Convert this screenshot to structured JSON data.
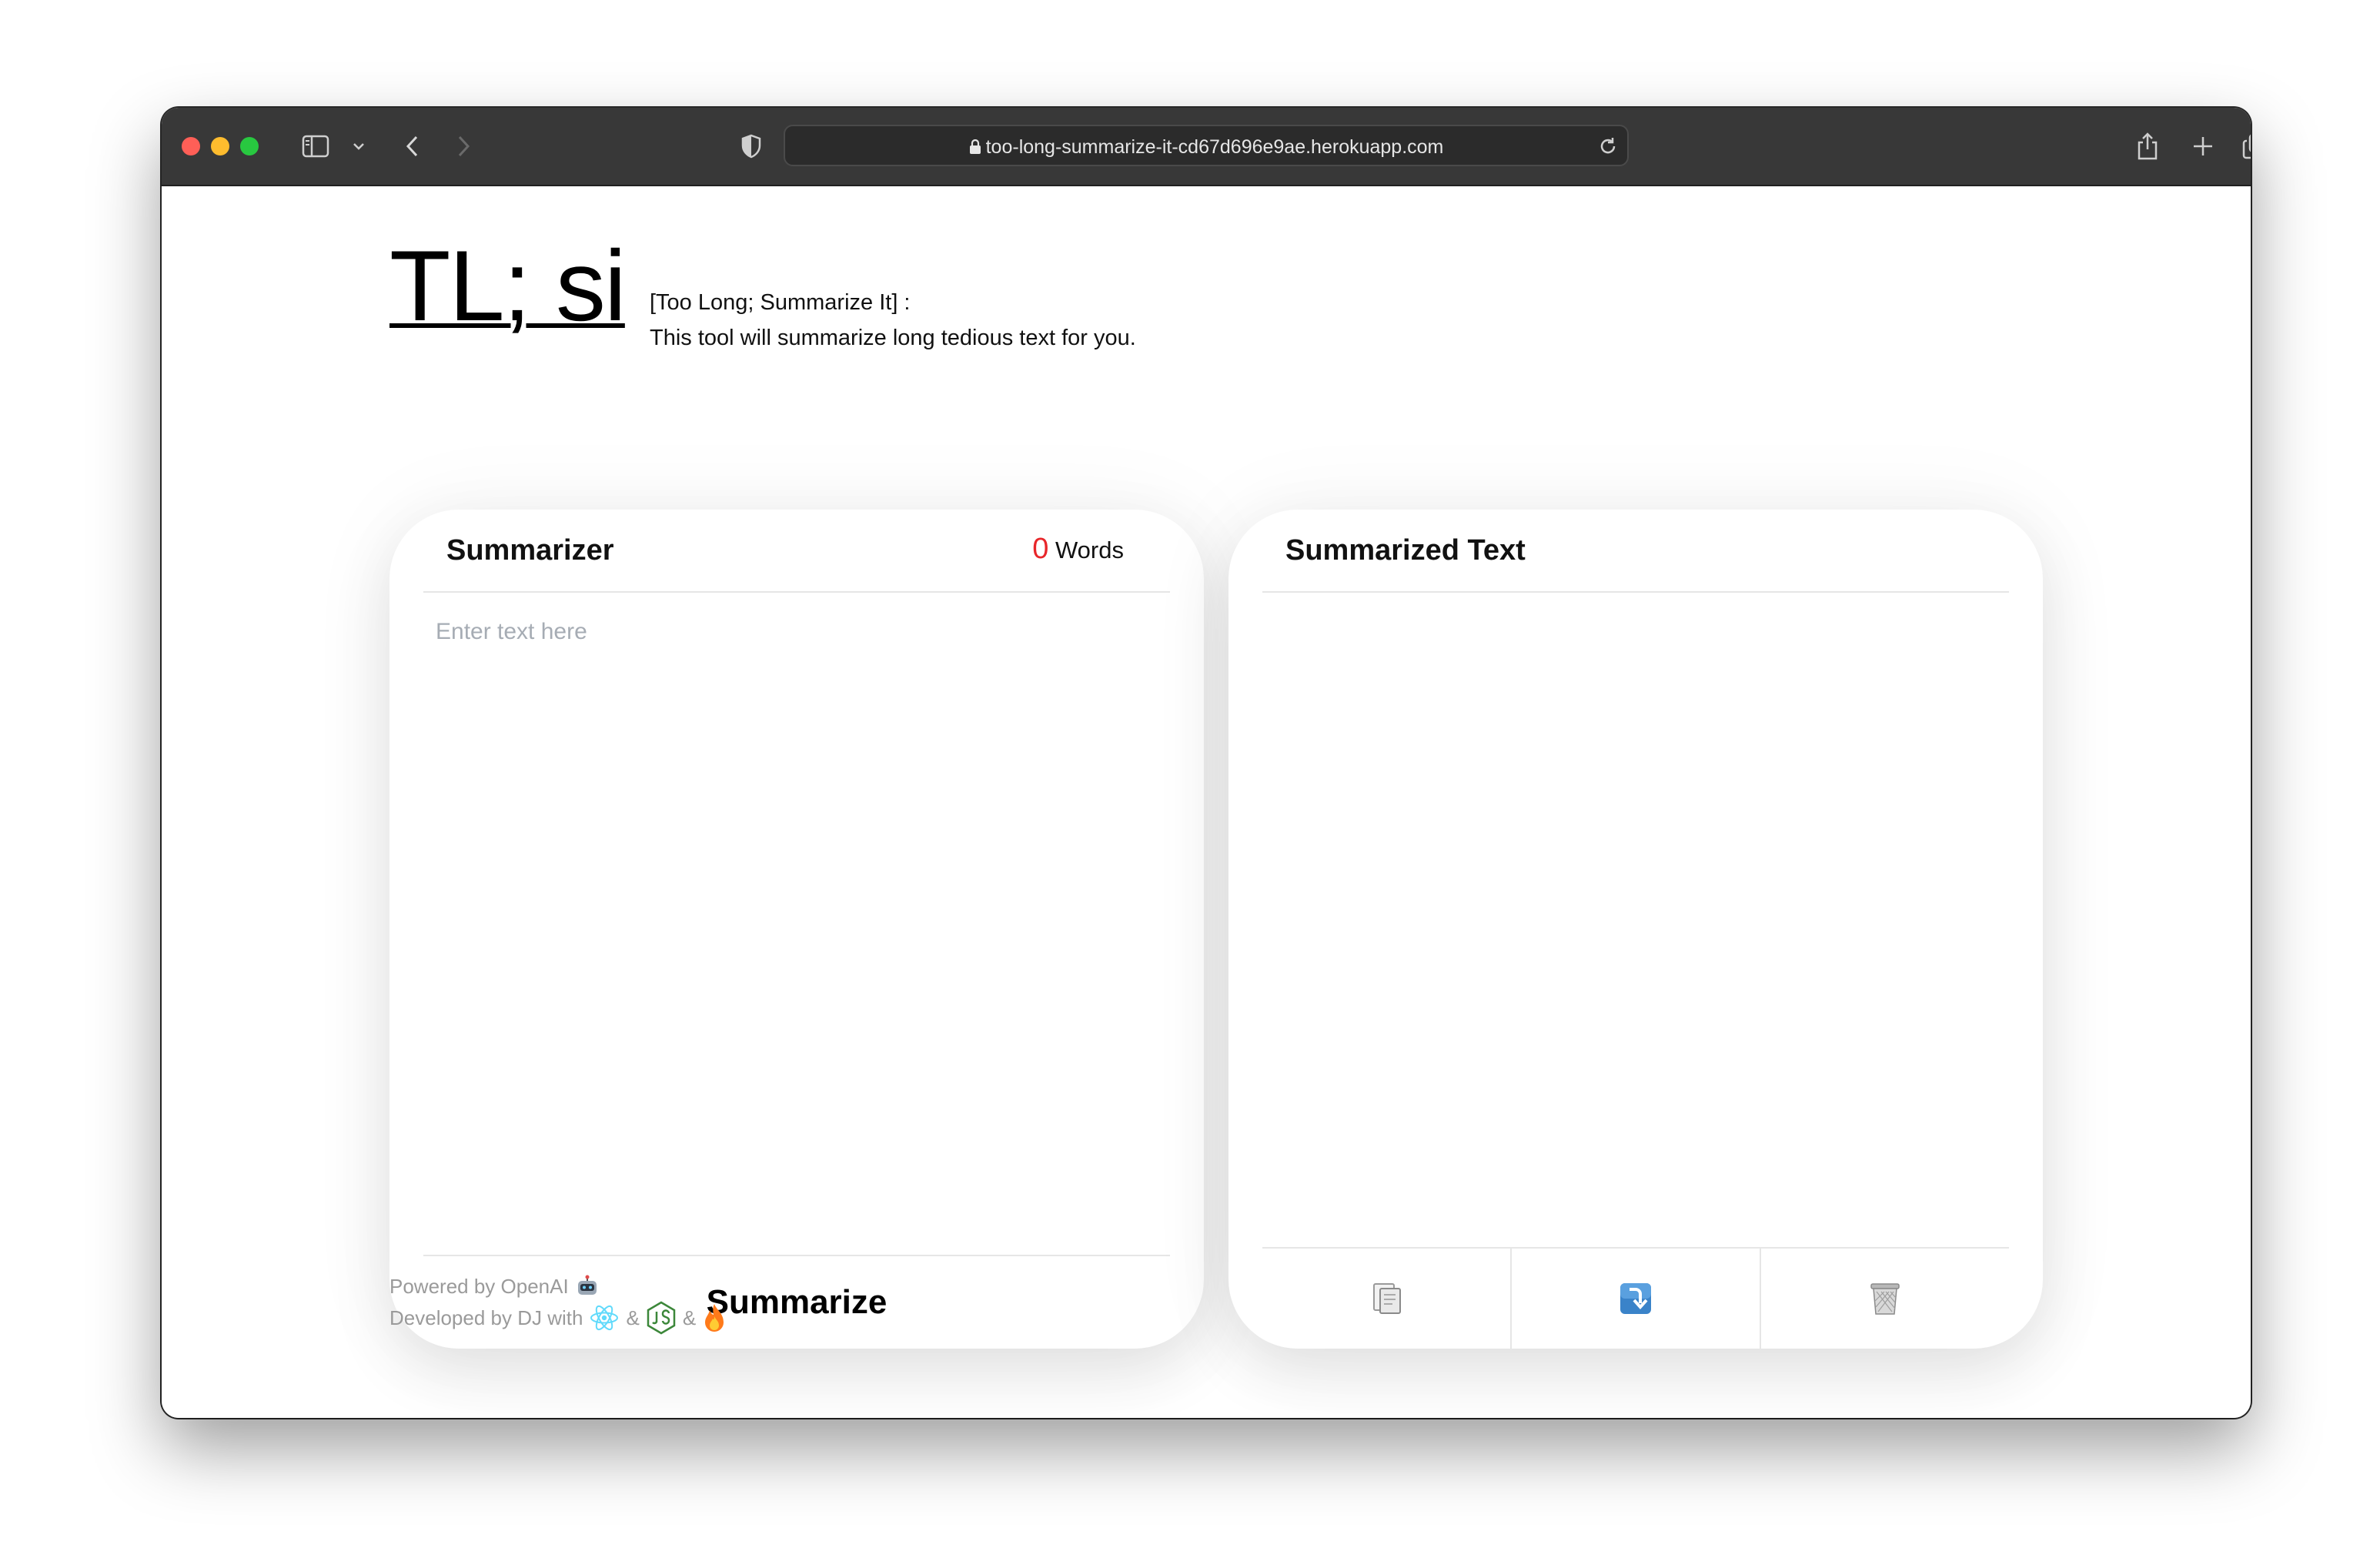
{
  "browser": {
    "url": "too-long-summarize-it-cd67d696e9ae.herokuapp.com",
    "traffic_light_colors": [
      "#ff5f57",
      "#febc2e",
      "#28c840"
    ]
  },
  "header": {
    "logo": "TL; si",
    "tagline_line1": "[Too Long; Summarize It] :",
    "tagline_line2": "This tool will summarize long tedious text for you."
  },
  "summarizer": {
    "title": "Summarizer",
    "word_count": "0",
    "word_label": "Words",
    "placeholder": "Enter text here",
    "button_label": "Summarize"
  },
  "output": {
    "title": "Summarized Text",
    "actions": [
      "copy-icon",
      "download-icon",
      "trash-icon"
    ]
  },
  "footer": {
    "line1": "Powered by OpenAI",
    "line2": "Developed by DJ with",
    "amp": "&"
  },
  "colors": {
    "accent_red": "#e8262a",
    "react_blue": "#61dafb",
    "node_green": "#3c873a",
    "firebase_orange": "#ff7a1a"
  }
}
